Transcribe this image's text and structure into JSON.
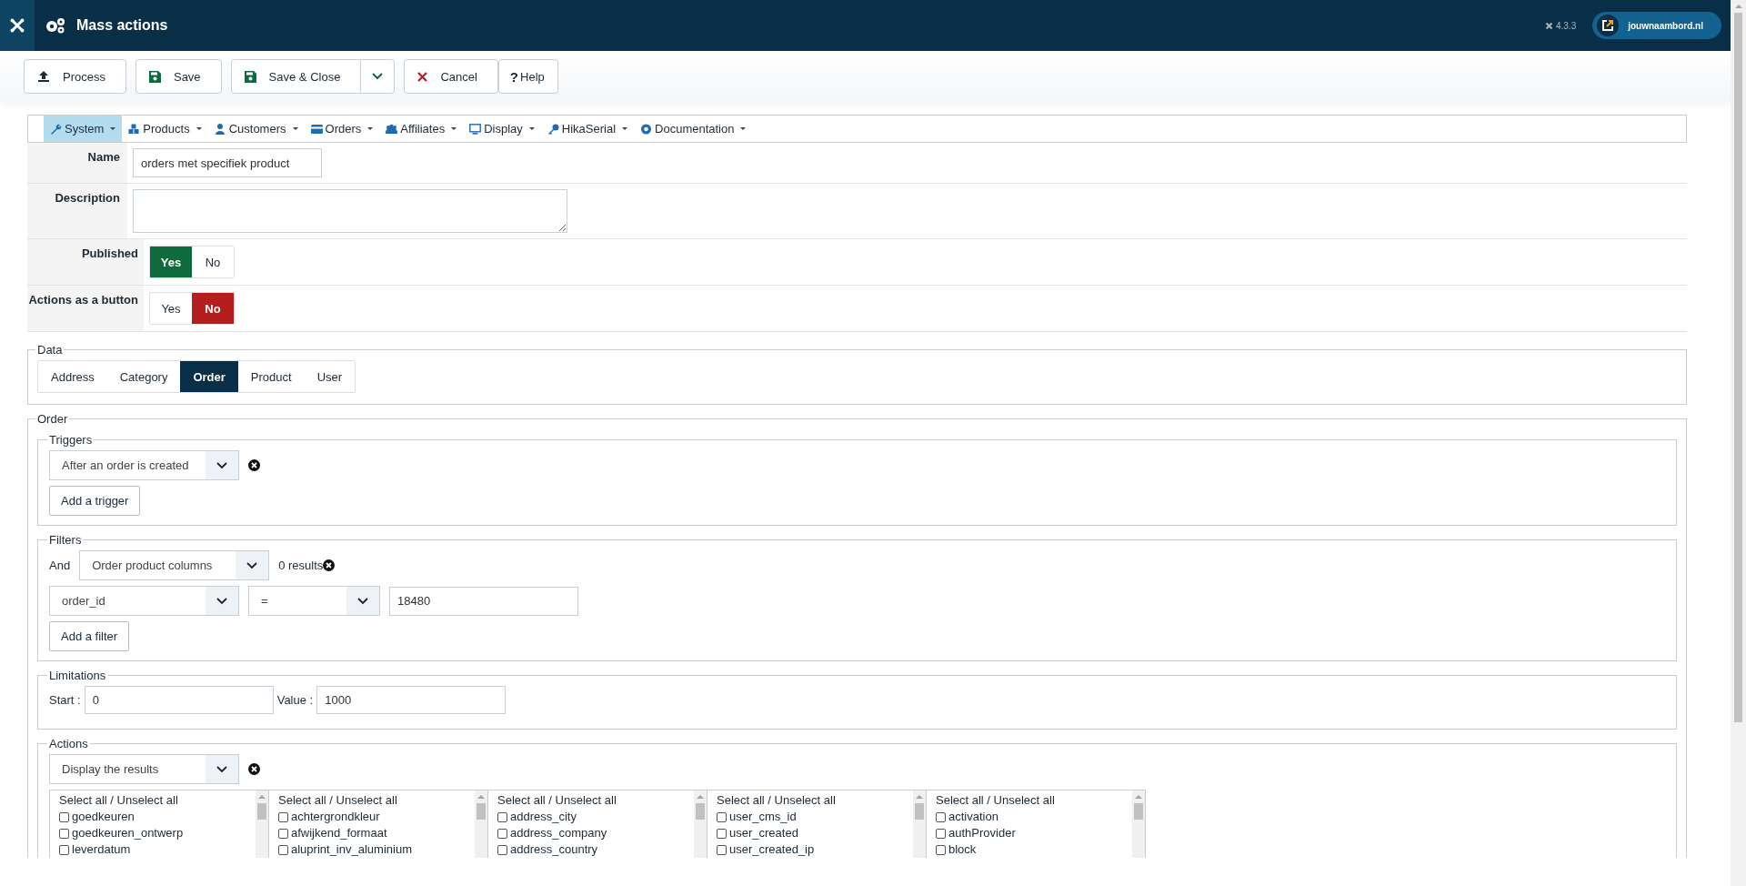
{
  "header": {
    "title": "Mass actions",
    "version": "4.3.3",
    "site_link": "jouwnaambord.nl"
  },
  "toolbar": [
    {
      "kind": "process",
      "label": "Process"
    },
    {
      "kind": "save",
      "label": "Save"
    },
    {
      "kind": "save_close",
      "label": "Save & Close"
    },
    {
      "kind": "dropdown"
    },
    {
      "kind": "cancel",
      "label": "Cancel"
    },
    {
      "kind": "help",
      "label": "Help",
      "glyph": "?"
    }
  ],
  "menu": [
    {
      "label": "System",
      "selected": true
    },
    {
      "label": "Products",
      "selected": false
    },
    {
      "label": "Customers",
      "selected": false
    },
    {
      "label": "Orders",
      "selected": false
    },
    {
      "label": "Affiliates",
      "selected": false
    },
    {
      "label": "Display",
      "selected": false
    },
    {
      "label": "HikaSerial",
      "selected": false
    },
    {
      "label": "Documentation",
      "selected": false
    }
  ],
  "name": {
    "label": "Name",
    "value": "orders met specifiek product"
  },
  "description": {
    "label": "Description"
  },
  "toggles": [
    {
      "label": "Published",
      "options": [
        {
          "label": "Yes",
          "selected": true
        },
        {
          "label": "No",
          "selected": false
        }
      ]
    },
    {
      "label": "Actions as a button",
      "options": [
        {
          "label": "Yes",
          "selected": false
        },
        {
          "label": "No",
          "selected": true
        }
      ]
    }
  ],
  "data": {
    "legend": "Data",
    "tabs": [
      {
        "label": "Address",
        "selected": false
      },
      {
        "label": "Category",
        "selected": false
      },
      {
        "label": "Order",
        "selected": true
      },
      {
        "label": "Product",
        "selected": false
      },
      {
        "label": "User",
        "selected": false
      }
    ]
  },
  "order": {
    "legend": "Order",
    "triggers": {
      "legend": "Triggers",
      "select": "After an order is created",
      "add": "Add a trigger"
    },
    "filters": {
      "legend": "Filters",
      "conjunction": "And",
      "type_select": "Order product columns",
      "results": "0 results",
      "field_select": "order_id",
      "operator_select": "=",
      "value": "18480",
      "add": "Add a filter"
    },
    "limitations": {
      "legend": "Limitations",
      "start_label": "Start :",
      "start_value": "0",
      "value_label": "Value :",
      "value_value": "1000"
    },
    "actions": {
      "legend": "Actions",
      "select": "Display the results",
      "lists": [
        {
          "header": "Select all / Unselect all",
          "items": [
            {
              "label": "goedkeuren",
              "checked": false
            },
            {
              "label": "goedkeuren_ontwerp",
              "checked": false
            },
            {
              "label": "leverdatum",
              "checked": false
            }
          ]
        },
        {
          "header": "Select all / Unselect all",
          "items": [
            {
              "label": "achtergrondkleur",
              "checked": false
            },
            {
              "label": "afwijkend_formaat",
              "checked": false
            },
            {
              "label": "aluprint_inv_aluminium",
              "checked": false
            }
          ]
        },
        {
          "header": "Select all / Unselect all",
          "items": [
            {
              "label": "address_city",
              "checked": false
            },
            {
              "label": "address_company",
              "checked": false
            },
            {
              "label": "address_country",
              "checked": false
            }
          ]
        },
        {
          "header": "Select all / Unselect all",
          "items": [
            {
              "label": "user_cms_id",
              "checked": false
            },
            {
              "label": "user_created",
              "checked": false
            },
            {
              "label": "user_created_ip",
              "checked": false
            }
          ]
        },
        {
          "header": "Select all / Unselect all",
          "items": [
            {
              "label": "activation",
              "checked": false
            },
            {
              "label": "authProvider",
              "checked": false
            },
            {
              "label": "block",
              "checked": false
            }
          ]
        }
      ]
    }
  }
}
